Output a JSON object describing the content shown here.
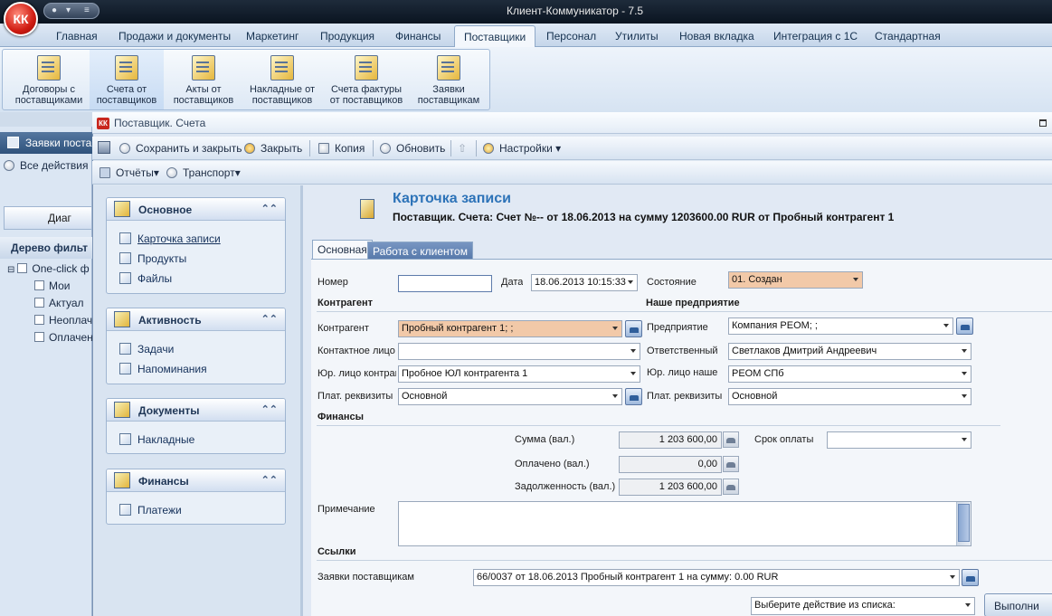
{
  "app": {
    "title": "Клиент-Коммуникатор - 7.5",
    "logo": "КК"
  },
  "ribbon_tabs": [
    "Главная",
    "Продажи и документы",
    "Маркетинг",
    "Продукция",
    "Финансы",
    "Поставщики",
    "Персонал",
    "Утилиты",
    "Новая вкладка",
    "Интеграция с 1С",
    "Стандартная"
  ],
  "ribbon_active_tab": "Поставщики",
  "ribbon_buttons": [
    {
      "line1": "Договоры с",
      "line2": "поставщиками",
      "icon": "contract-icon"
    },
    {
      "line1": "Счета от",
      "line2": "поставщиков",
      "icon": "invoice-icon"
    },
    {
      "line1": "Акты от",
      "line2": "поставщиков",
      "icon": "act-icon"
    },
    {
      "line1": "Накладные от",
      "line2": "поставщиков",
      "icon": "waybill-icon"
    },
    {
      "line1": "Счета фактуры",
      "line2": "от поставщиков",
      "icon": "tax-invoice-icon"
    },
    {
      "line1": "Заявки",
      "line2": "поставщикам",
      "icon": "request-icon"
    }
  ],
  "left_pane": {
    "header": "Заявки поставщ",
    "all_actions": "Все действия",
    "diagram_btn": "Диаг",
    "tree_header": "Дерево фильт",
    "tree_root": "One-click ф",
    "tree_items": [
      "Мои",
      "Актуал",
      "Неоплач",
      "Оплачен"
    ]
  },
  "window": {
    "title": "Поставщик. Счета",
    "toolbar1": {
      "save_close": "Сохранить и закрыть",
      "close": "Закрыть",
      "copy": "Копия",
      "refresh": "Обновить",
      "settings": "Настройки"
    },
    "toolbar2": {
      "reports": "Отчёты",
      "transport": "Транспорт"
    }
  },
  "nav_groups": [
    {
      "title": "Основное",
      "items": [
        "Карточка записи",
        "Продукты",
        "Файлы"
      ]
    },
    {
      "title": "Активность",
      "items": [
        "Задачи",
        "Напоминания"
      ]
    },
    {
      "title": "Документы",
      "items": [
        "Накладные"
      ]
    },
    {
      "title": "Финансы",
      "items": [
        "Платежи"
      ]
    }
  ],
  "card": {
    "title": "Карточка записи",
    "subtitle": "Поставщик. Счета: Счет №-- от 18.06.2013 на сумму 1203600.00 RUR от Пробный контрагент 1"
  },
  "form_tabs": [
    "Основная",
    "Работа с клиентом"
  ],
  "form": {
    "number_label": "Номер",
    "number_value": "",
    "date_label": "Дата",
    "date_value": "18.06.2013 10:15:33",
    "state_label": "Состояние",
    "state_value": "01. Создан",
    "sec_counterparty": "Контрагент",
    "sec_our": "Наше предприятие",
    "counterparty_label": "Контрагент",
    "counterparty_value": "Пробный контрагент 1; ;",
    "contact_label": "Контактное лицо",
    "contact_value": "",
    "legal_label": "Юр. лицо контраг",
    "legal_value": "Пробное ЮЛ контрагента 1",
    "pay_label": "Плат. реквизиты",
    "pay_value": "Основной",
    "company_label": "Предприятие",
    "company_value": "Компания РЕОМ; ;",
    "resp_label": "Ответственный",
    "resp_value": "Светлаков Дмитрий Андреевич",
    "our_legal_label": "Юр. лицо наше",
    "our_legal_value": "РЕОМ СПб",
    "our_pay_label": "Плат. реквизиты",
    "our_pay_value": "Основной",
    "sec_finance": "Финансы",
    "sum_label": "Сумма (вал.)",
    "sum_value": "1 203 600,00",
    "paid_label": "Оплачено (вал.)",
    "paid_value": "0,00",
    "debt_label": "Задолженность (вал.)",
    "debt_value": "1 203 600,00",
    "term_label": "Срок оплаты",
    "term_value": "",
    "note_label": "Примечание",
    "sec_links": "Ссылки",
    "req_label": "Заявки поставщикам",
    "req_value": "66/0037 от 18.06.2013 Пробный контрагент 1 на сумму: 0.00 RUR"
  },
  "bottom": {
    "action_placeholder": "Выберите действие из списка:",
    "execute": "Выполни"
  },
  "colors": {
    "accent": "#2d73b8",
    "peach": "#f2c9a8"
  }
}
